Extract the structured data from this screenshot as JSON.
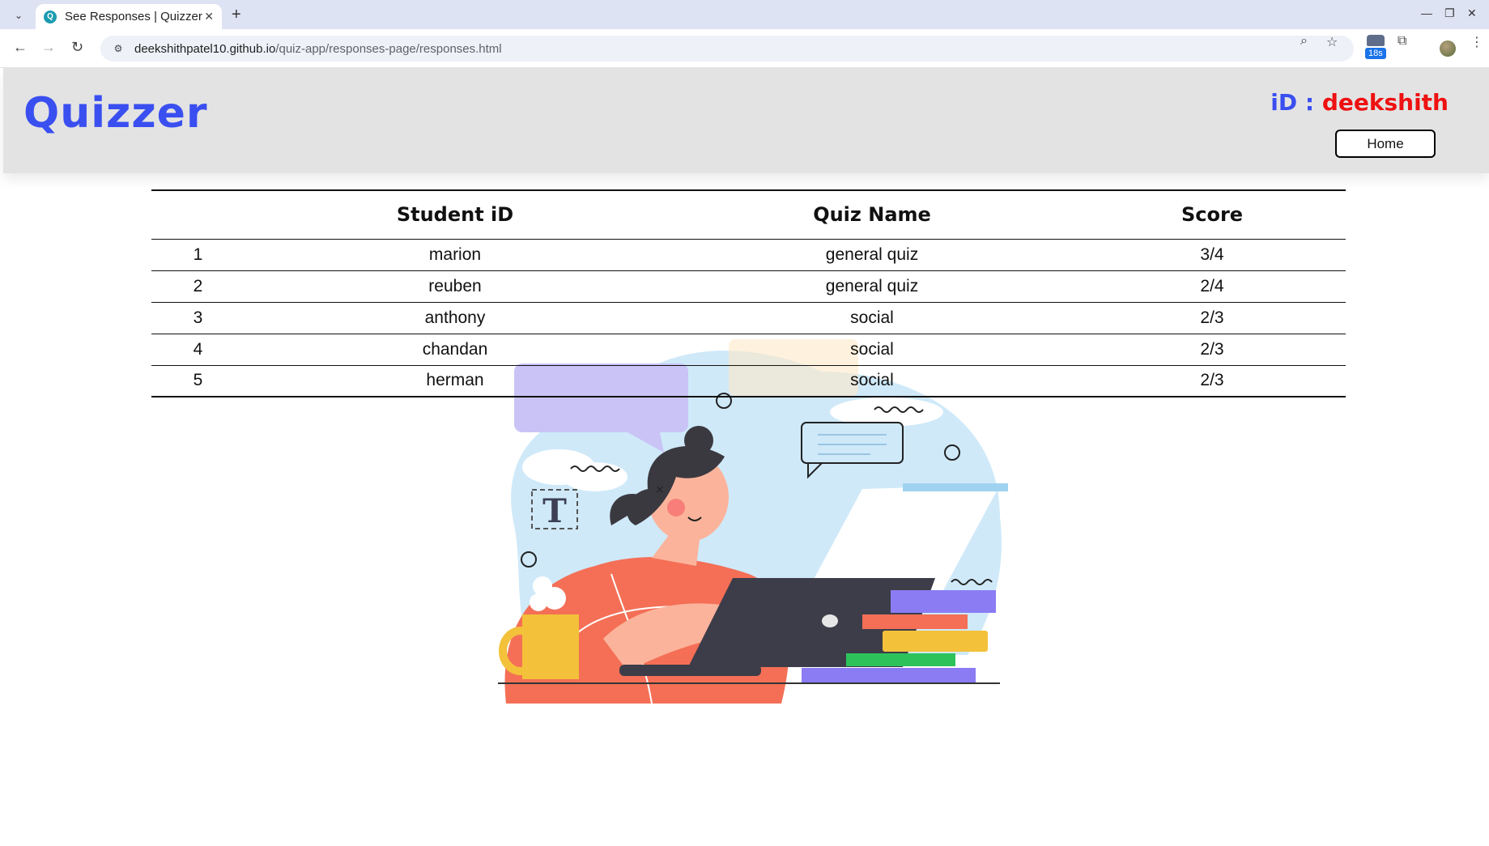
{
  "browser": {
    "tab_title": "See Responses | Quizzer",
    "url_host": "deekshithpatel10.github.io",
    "url_path": "/quiz-app/responses-page/responses.html",
    "extension_badge": "18s"
  },
  "header": {
    "brand": "Quizzer",
    "id_label": "iD :",
    "id_value": "deekshith",
    "home_button": "Home"
  },
  "table": {
    "columns": [
      "",
      "Student iD",
      "Quiz Name",
      "Score"
    ],
    "rows": [
      {
        "num": "1",
        "student": "marion",
        "quiz": "general quiz",
        "score": "3/4"
      },
      {
        "num": "2",
        "student": "reuben",
        "quiz": "general quiz",
        "score": "2/4"
      },
      {
        "num": "3",
        "student": "anthony",
        "quiz": "social",
        "score": "2/3"
      },
      {
        "num": "4",
        "student": "chandan",
        "quiz": "social",
        "score": "2/3"
      },
      {
        "num": "5",
        "student": "herman",
        "quiz": "social",
        "score": "2/3"
      }
    ]
  },
  "illustration": {
    "icon": "woman-studying-laptop-illustration",
    "letter": "T"
  }
}
